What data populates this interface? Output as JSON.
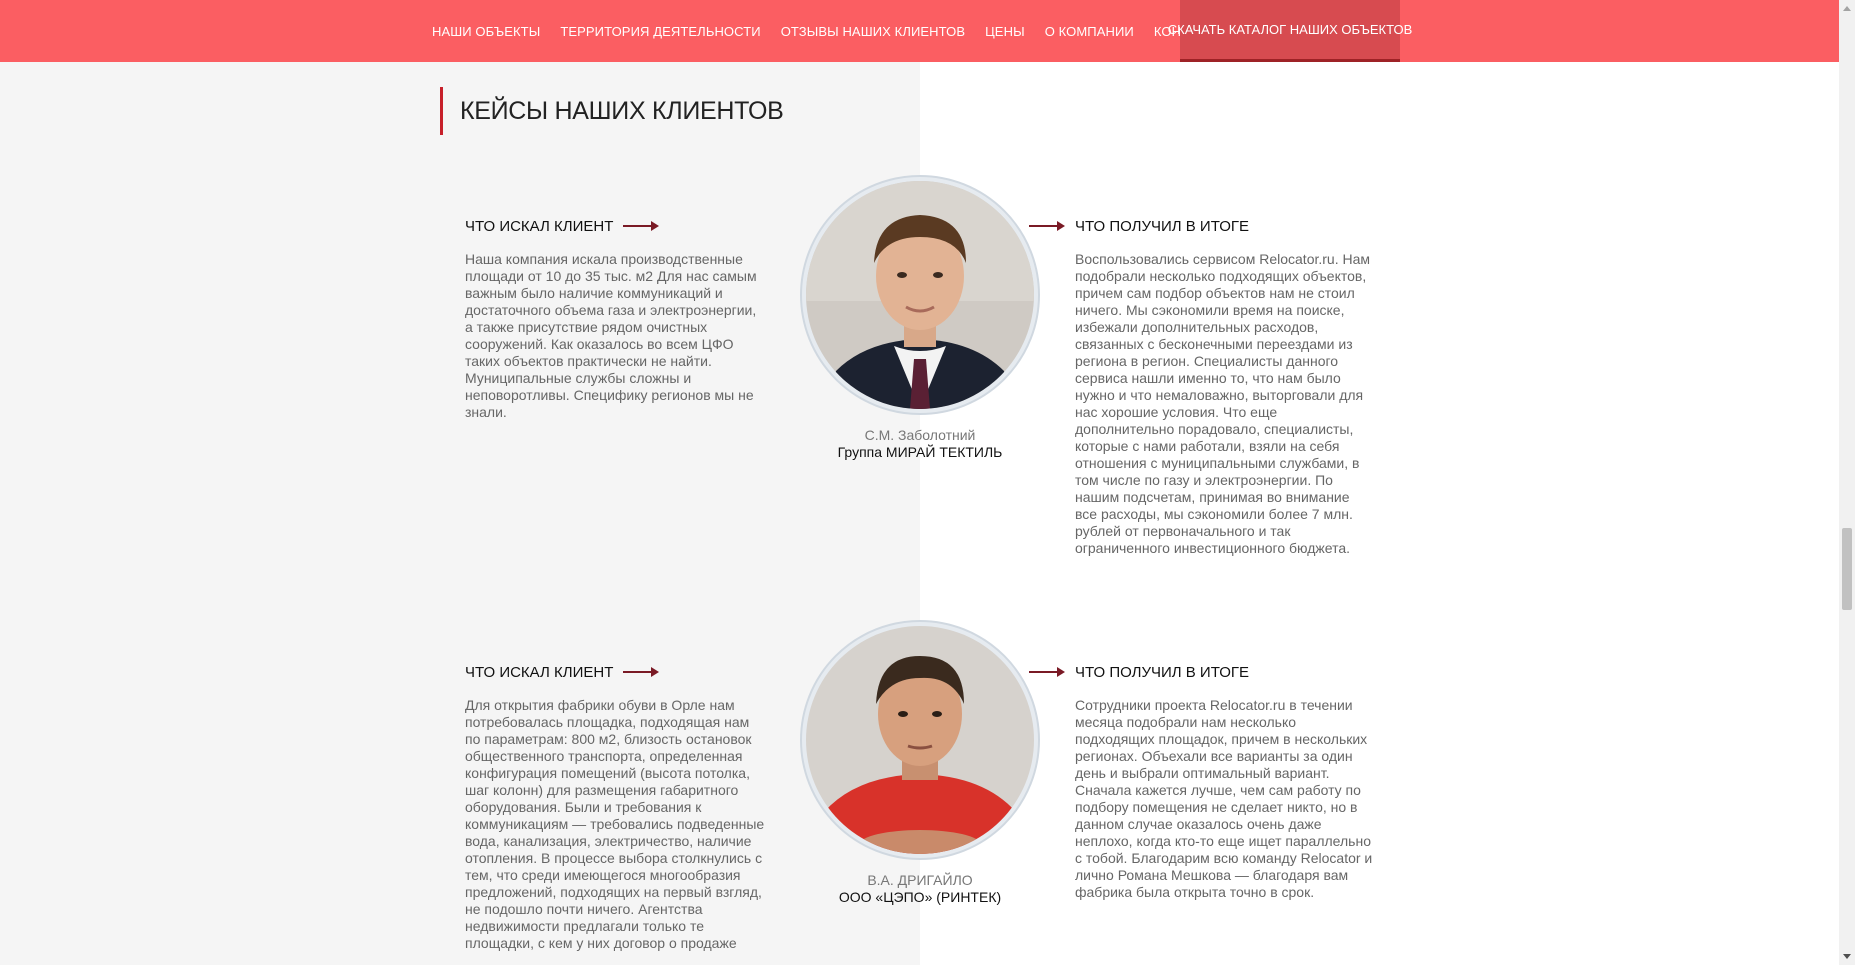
{
  "nav": {
    "items": [
      "НАШИ ОБЪЕКТЫ",
      "ТЕРРИТОРИЯ ДЕЯТЕЛЬНОСТИ",
      "ОТЗЫВЫ НАШИХ КЛИЕНТОВ",
      "ЦЕНЫ",
      "О КОМПАНИИ",
      "КОНТАКТЫ"
    ],
    "cta": "СКАЧАТЬ КАТАЛОГ НАШИХ ОБЪЕКТОВ"
  },
  "section": {
    "title": "КЕЙСЫ НАШИХ КЛИЕНТОВ"
  },
  "cases": [
    {
      "left_heading": "ЧТО ИСКАЛ КЛИЕНТ",
      "left_text": "Наша компания искала производственные площади от 10 до 35 тыс. м2 Для нас самым важным было наличие коммуникаций и достаточного объема газа и электроэнергии, а также присутствие рядом очистных сооружений. Как оказалось во всем ЦФО таких объектов практически не найти. Муниципальные службы сложны и неповоротливы. Специфику регионов мы не знали.",
      "right_heading": "ЧТО ПОЛУЧИЛ В ИТОГЕ",
      "right_text": "Воспользовались сервисом Relocator.ru. Нам подобрали несколько подходящих объектов, причем сам подбор объектов нам не стоил ничего. Мы сэкономили время на поиске, избежали дополнительных расходов, связанных с бесконечными переездами из региона в регион. Специалисты данного сервиса нашли именно то, что нам было нужно и что немаловажно, выторговали для нас хорошие условия. Что еще дополнительно порадовало, специалисты, которые с нами работали, взяли на себя отношения с муниципальными службами, в том числе по газу и электроэнергии. По нашим подсчетам, принимая во внимание все расходы, мы сэкономили более 7 млн. рублей от первоначального и так ограниченного инвестиционного бюджета.",
      "name": "С.М. Заболотний",
      "company": "Группа МИРАЙ ТЕКТИЛЬ"
    },
    {
      "left_heading": "ЧТО ИСКАЛ КЛИЕНТ",
      "left_text": "Для открытия фабрики обуви в Орле нам потребовалась площадка, подходящая нам по параметрам: 800 м2, близость остановок общественного транспорта, определенная конфигурация помещений (высота потолка, шаг колонн) для размещения габаритного оборудования. Были и требования к коммуникациям — требовались подведенные вода, канализация, электричество, наличие отопления. В процессе выбора столкнулись с тем, что среди имеющегося многообразия предложений, подходящих на первый взгляд, не подошло почти ничего. Агентства недвижимости предлагали только те площадки, с кем у них договор о продаже",
      "right_heading": "ЧТО ПОЛУЧИЛ В ИТОГЕ",
      "right_text": "Сотрудники проекта Relocator.ru в течении месяца подобрали нам несколько подходящих площадок, причем в нескольких регионах. Объехали все варианты за один день и выбрали оптимальный вариант. Сначала кажется лучше, чем сам работу по подбору помещения не сделает никто, но в данном случае оказалось очень даже неплохо, когда кто-то еще ищет параллельно с тобой. Благодарим всю команду Relocator и лично Романа Мешкова — благодаря вам фабрика была открыта точно в срок.",
      "name": "В.А. ДРИГАЙЛО",
      "company": "ООО «ЦЭПО» (РИНТЕК)"
    }
  ],
  "colors": {
    "nav_bg": "#fb5e62",
    "cta_bg": "#d74b50",
    "accent": "#c7202a",
    "arrow": "#7a1a25"
  }
}
